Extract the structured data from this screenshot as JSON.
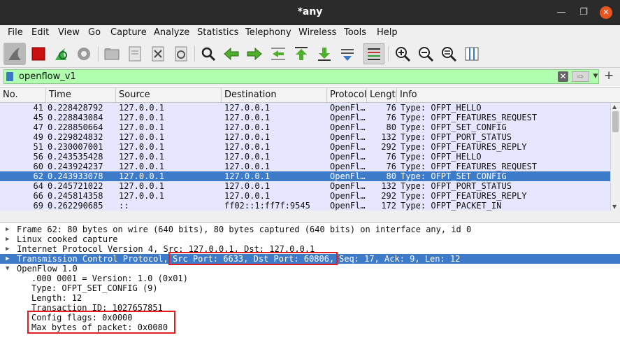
{
  "window": {
    "title": "*any",
    "minimize": "—",
    "maximize": "❐",
    "close": "✕"
  },
  "menu": [
    "File",
    "Edit",
    "View",
    "Go",
    "Capture",
    "Analyze",
    "Statistics",
    "Telephony",
    "Wireless",
    "Tools",
    "Help"
  ],
  "filter": {
    "value": "openflow_v1",
    "clear_glyph": "✕",
    "apply_glyph": "⇨",
    "dropdown_glyph": "▼",
    "add_glyph": "+"
  },
  "columns": [
    "No.",
    "Time",
    "Source",
    "Destination",
    "Protocol",
    "Length",
    "Info"
  ],
  "packets": [
    {
      "no": "41",
      "time": "0.228428792",
      "src": "127.0.0.1",
      "dst": "127.0.0.1",
      "proto": "OpenFl…",
      "len": "76",
      "info": "Type: OFPT_HELLO",
      "selected": false
    },
    {
      "no": "45",
      "time": "0.228843084",
      "src": "127.0.0.1",
      "dst": "127.0.0.1",
      "proto": "OpenFl…",
      "len": "76",
      "info": "Type: OFPT_FEATURES_REQUEST",
      "selected": false
    },
    {
      "no": "47",
      "time": "0.228850664",
      "src": "127.0.0.1",
      "dst": "127.0.0.1",
      "proto": "OpenFl…",
      "len": "80",
      "info": "Type: OFPT_SET_CONFIG",
      "selected": false
    },
    {
      "no": "49",
      "time": "0.229824832",
      "src": "127.0.0.1",
      "dst": "127.0.0.1",
      "proto": "OpenFl…",
      "len": "132",
      "info": "Type: OFPT_PORT_STATUS",
      "selected": false
    },
    {
      "no": "51",
      "time": "0.230007001",
      "src": "127.0.0.1",
      "dst": "127.0.0.1",
      "proto": "OpenFl…",
      "len": "292",
      "info": "Type: OFPT_FEATURES_REPLY",
      "selected": false
    },
    {
      "no": "56",
      "time": "0.243535428",
      "src": "127.0.0.1",
      "dst": "127.0.0.1",
      "proto": "OpenFl…",
      "len": "76",
      "info": "Type: OFPT_HELLO",
      "selected": false
    },
    {
      "no": "60",
      "time": "0.243924237",
      "src": "127.0.0.1",
      "dst": "127.0.0.1",
      "proto": "OpenFl…",
      "len": "76",
      "info": "Type: OFPT_FEATURES_REQUEST",
      "selected": false
    },
    {
      "no": "62",
      "time": "0.243933078",
      "src": "127.0.0.1",
      "dst": "127.0.0.1",
      "proto": "OpenFl…",
      "len": "80",
      "info": "Type: OFPT_SET_CONFIG",
      "selected": true
    },
    {
      "no": "64",
      "time": "0.245721022",
      "src": "127.0.0.1",
      "dst": "127.0.0.1",
      "proto": "OpenFl…",
      "len": "132",
      "info": "Type: OFPT_PORT_STATUS",
      "selected": false
    },
    {
      "no": "66",
      "time": "0.245814358",
      "src": "127.0.0.1",
      "dst": "127.0.0.1",
      "proto": "OpenFl…",
      "len": "292",
      "info": "Type: OFPT_FEATURES_REPLY",
      "selected": false
    },
    {
      "no": "69",
      "time": "0.262290685",
      "src": "::",
      "dst": "ff02::1:ff7f:9545",
      "proto": "OpenFl…",
      "len": "172",
      "info": "Type: OFPT_PACKET_IN",
      "selected": false
    }
  ],
  "details": {
    "frame": "Frame 62: 80 bytes on wire (640 bits), 80 bytes captured (640 bits) on interface any, id 0",
    "linux": "Linux cooked capture",
    "ip": "Internet Protocol Version 4, Src: 127.0.0.1, Dst: 127.0.0.1",
    "tcp_prefix": "Transmission Control Protocol,",
    "tcp_ports": "Src Port: 6633, Dst Port: 60806,",
    "tcp_suffix": "Seq: 17, Ack: 9, Len: 12",
    "openflow": "OpenFlow 1.0",
    "version": ".000 0001 = Version: 1.0 (0x01)",
    "type": "Type: OFPT_SET_CONFIG (9)",
    "length": "Length: 12",
    "xid": "Transaction ID: 1027657851",
    "flags": "Config flags: 0x0000",
    "maxbytes": "Max bytes of packet: 0x0080"
  },
  "colors": {
    "row_bg": "#e7e6ff",
    "selected_bg": "#3d7ac8",
    "filter_ok_bg": "#afffaf",
    "highlight": "#e02020"
  },
  "arrows": {
    "collapsed": "▶",
    "expanded": "▼"
  },
  "icons": [
    "shark-fin-icon",
    "stop-icon",
    "restart-icon",
    "options-gear-icon",
    "open-file-icon",
    "save-file-icon",
    "close-file-icon",
    "reload-icon",
    "find-icon",
    "go-back-icon",
    "go-forward-icon",
    "go-to-packet-icon",
    "go-first-icon",
    "go-last-icon",
    "autoscroll-icon",
    "colorize-icon",
    "zoom-in-icon",
    "zoom-out-icon",
    "normal-size-icon",
    "resize-columns-icon"
  ]
}
